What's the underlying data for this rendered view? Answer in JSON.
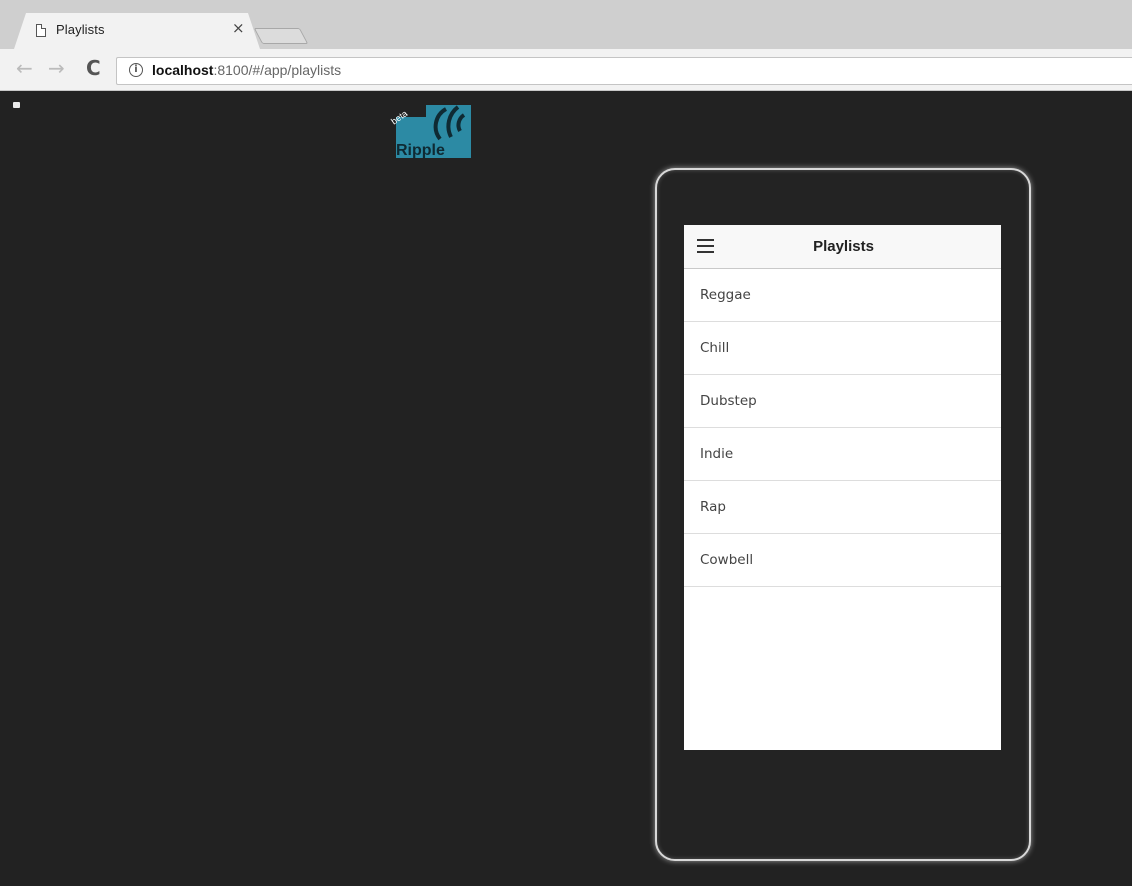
{
  "browser": {
    "tab_title": "Playlists",
    "tab_close": "×",
    "back_icon": "←",
    "forward_icon": "→",
    "reload_icon": "C",
    "info_icon": "i",
    "url_host": "localhost",
    "url_rest": ":8100/#/app/playlists"
  },
  "ripple": {
    "logo_text": "Ripple",
    "beta_text": "beta",
    "logo_color": "#2c8aa4"
  },
  "app": {
    "title": "Playlists",
    "menu_icon": "menu-icon",
    "items": [
      {
        "label": "Reggae"
      },
      {
        "label": "Chill"
      },
      {
        "label": "Dubstep"
      },
      {
        "label": "Indie"
      },
      {
        "label": "Rap"
      },
      {
        "label": "Cowbell"
      }
    ]
  }
}
